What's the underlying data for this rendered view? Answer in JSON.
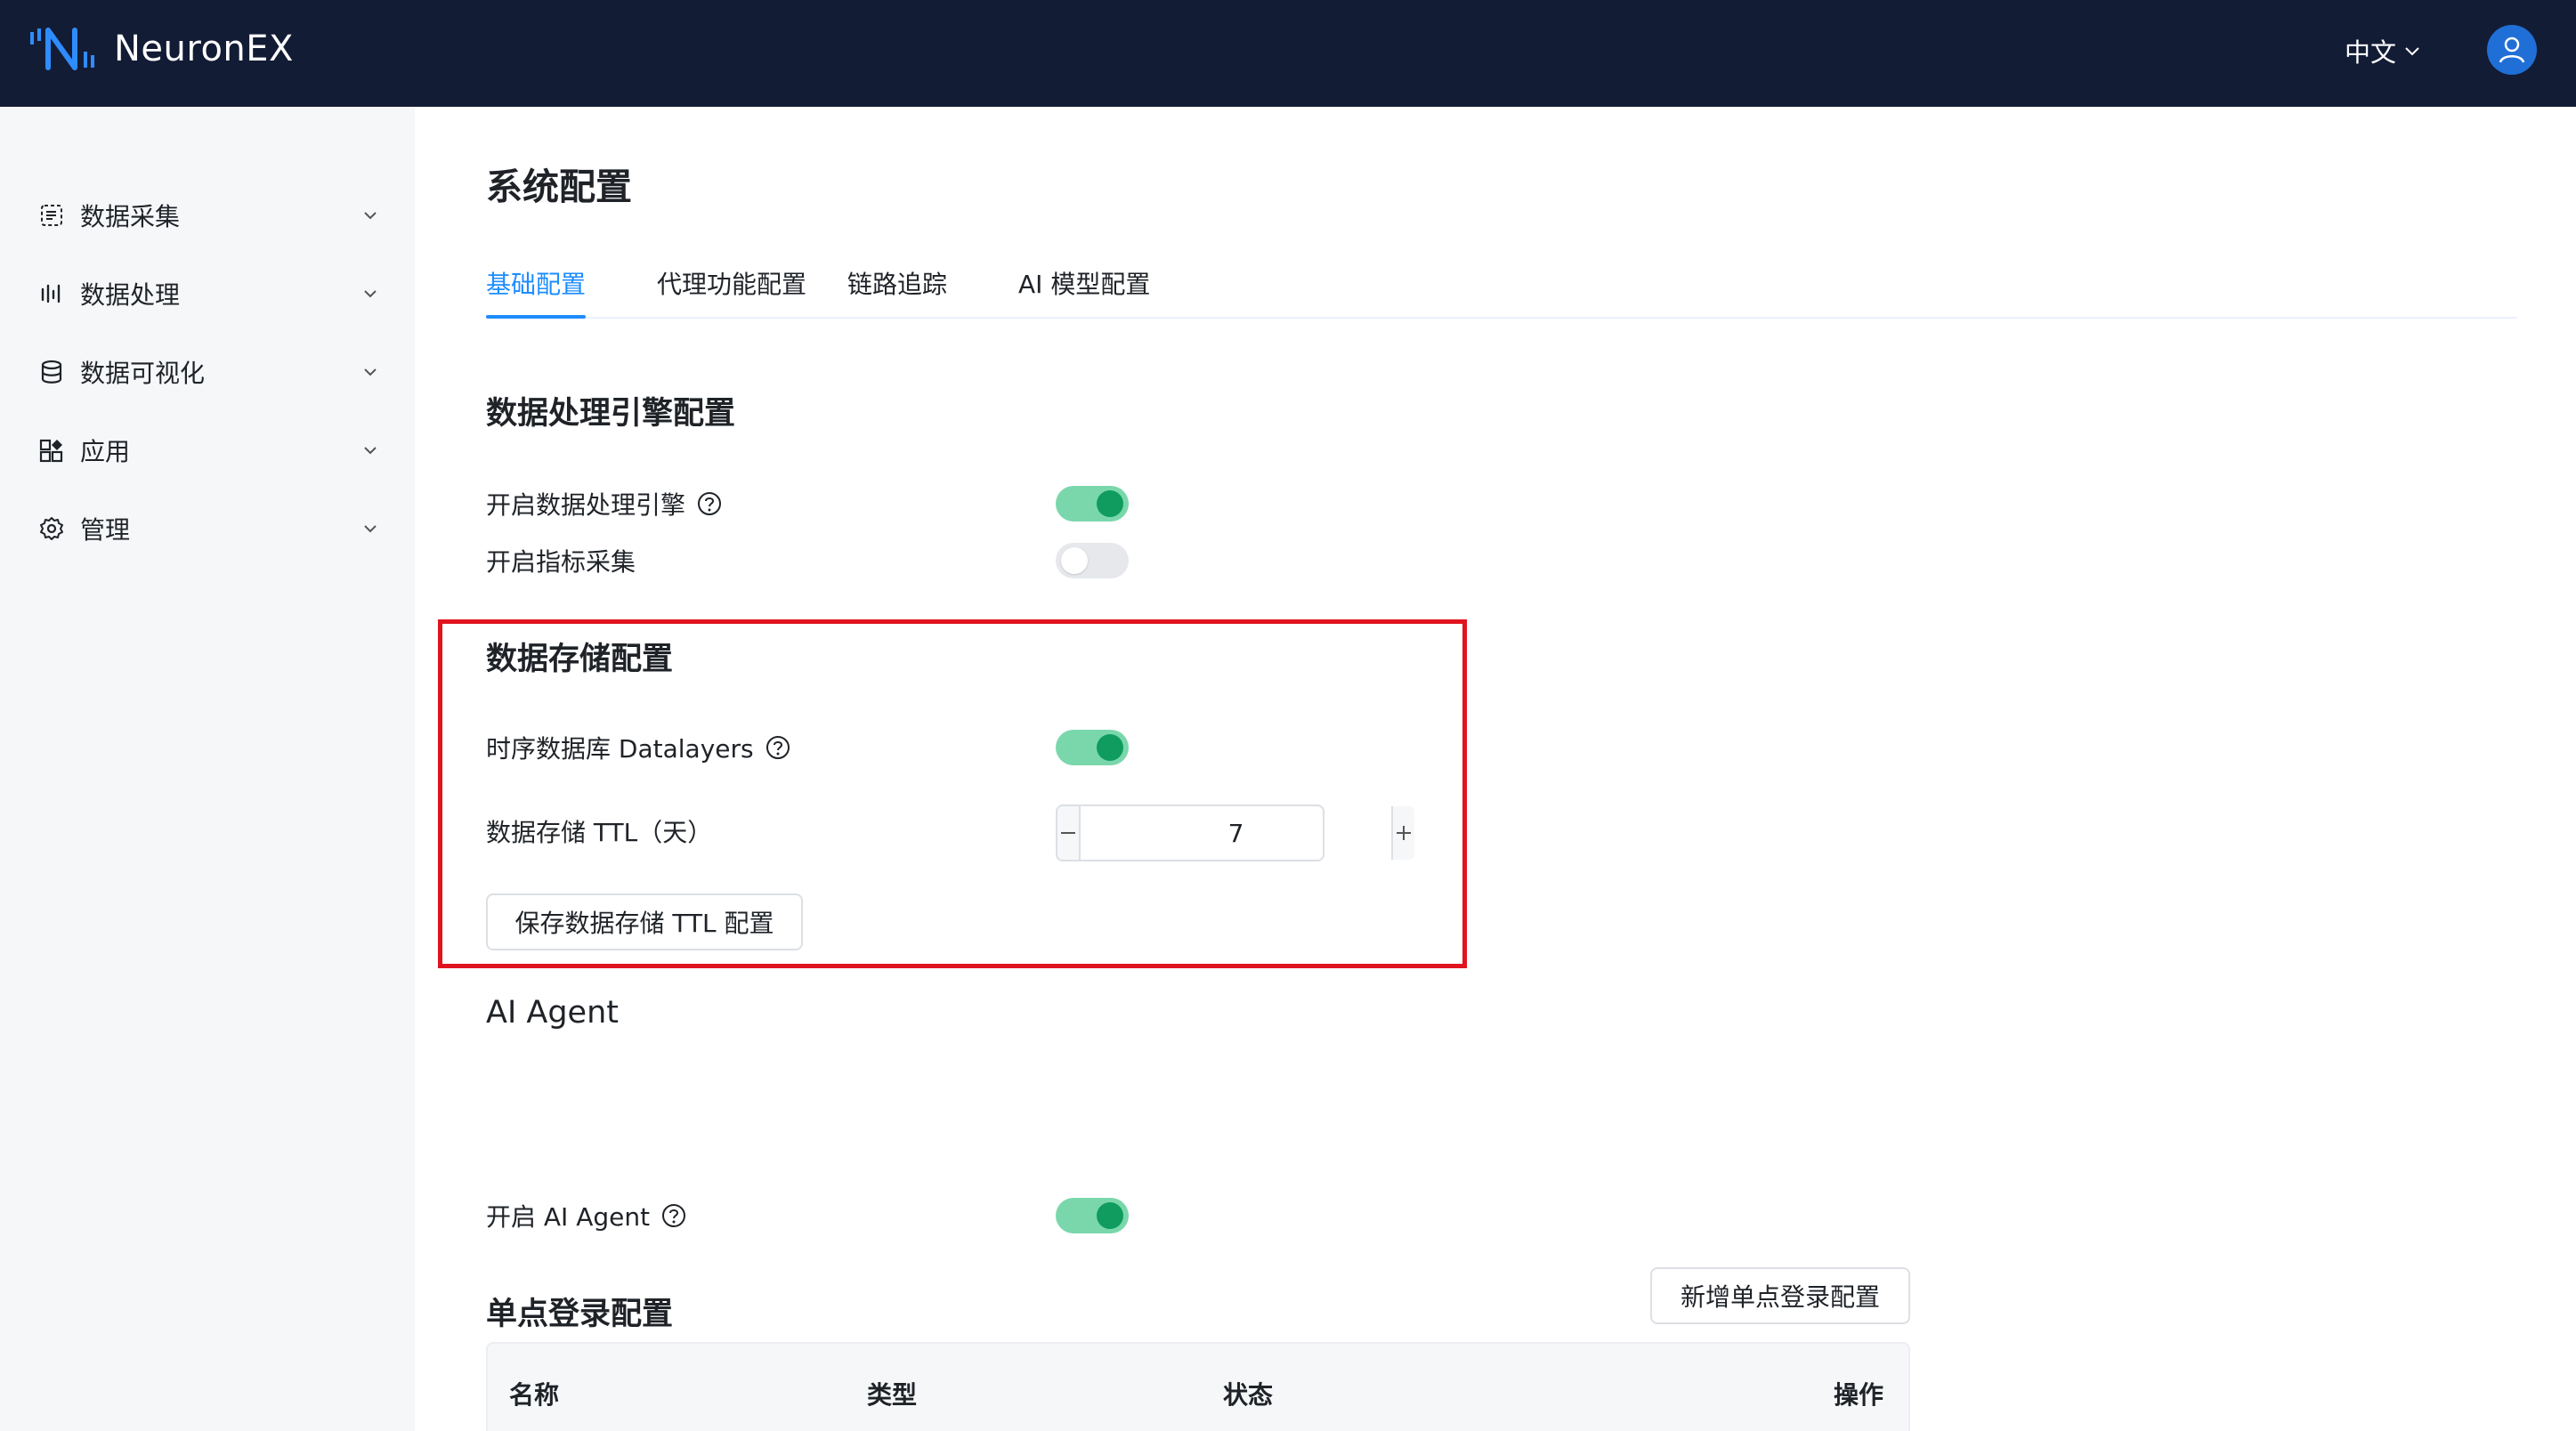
{
  "header": {
    "app_name": "NeuronEX",
    "language": "中文",
    "brand_color": "#131c35",
    "accent_color": "#1e8cff"
  },
  "sidebar": {
    "items": [
      {
        "label": "数据采集",
        "icon": "data-collection-icon"
      },
      {
        "label": "数据处理",
        "icon": "data-processing-icon"
      },
      {
        "label": "数据可视化",
        "icon": "database-icon"
      },
      {
        "label": "应用",
        "icon": "apps-icon"
      },
      {
        "label": "管理",
        "icon": "gear-icon"
      }
    ]
  },
  "main": {
    "title": "系统配置",
    "tabs": [
      {
        "label": "基础配置",
        "active": true
      },
      {
        "label": "代理功能配置",
        "active": false
      },
      {
        "label": "链路追踪",
        "active": false
      },
      {
        "label": "AI 模型配置",
        "active": false
      }
    ],
    "engine_section": {
      "title": "数据处理引擎配置",
      "enable_engine_label": "开启数据处理引擎",
      "enable_engine_on": true,
      "enable_metrics_label": "开启指标采集",
      "enable_metrics_on": false
    },
    "storage_section": {
      "title": "数据存储配置",
      "datalayers_label": "时序数据库 Datalayers",
      "datalayers_on": true,
      "ttl_label": "数据存储 TTL（天）",
      "ttl_value": "7",
      "save_button": "保存数据存储 TTL 配置"
    },
    "ai_section": {
      "title": "AI Agent",
      "enable_label": "开启 AI Agent",
      "enable_on": true
    },
    "sso_section": {
      "title": "单点登录配置",
      "add_button": "新增单点登录配置",
      "columns": [
        "名称",
        "类型",
        "状态",
        "操作"
      ]
    }
  }
}
